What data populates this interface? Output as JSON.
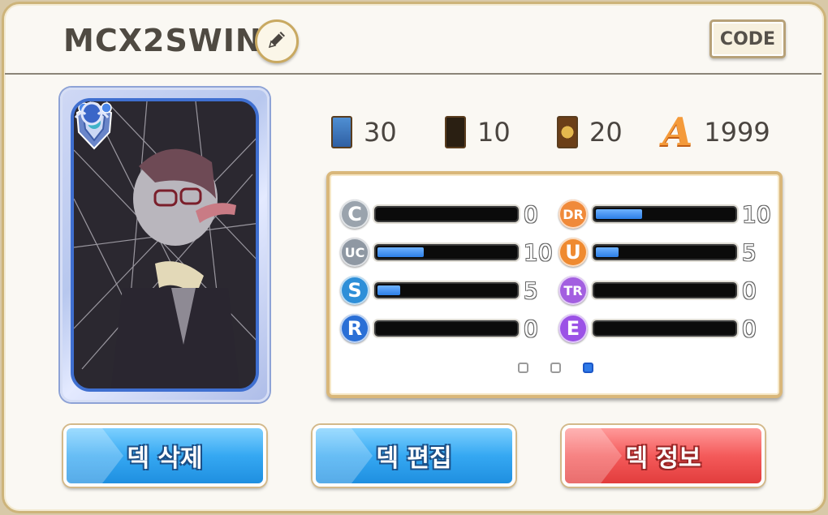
{
  "header": {
    "title": "MCX2SWIN",
    "code_label": "CODE"
  },
  "deck_counts": [
    {
      "icon": "blue-card-deck-icon",
      "value": "30"
    },
    {
      "icon": "silhouette-card-deck-icon",
      "value": "10"
    },
    {
      "icon": "gold-emblem-card-deck-icon",
      "value": "20"
    },
    {
      "icon": "rank-a-icon",
      "label": "A",
      "value": "1999"
    }
  ],
  "rarities": [
    {
      "label": "C",
      "value": "0",
      "fill": 0.0,
      "color": "#9aa3ad"
    },
    {
      "label": "UC",
      "value": "10",
      "fill": 0.33,
      "color": "#8f98a3"
    },
    {
      "label": "S",
      "value": "5",
      "fill": 0.16,
      "color": "#2e8fd8"
    },
    {
      "label": "R",
      "value": "0",
      "fill": 0.0,
      "color": "#2a6fd6"
    },
    {
      "label": "DR",
      "value": "10",
      "fill": 0.33,
      "color": "#f08a3a"
    },
    {
      "label": "U",
      "value": "5",
      "fill": 0.16,
      "color": "#ef8a30"
    },
    {
      "label": "TR",
      "value": "0",
      "fill": 0.0,
      "color": "#a35fe0"
    },
    {
      "label": "E",
      "value": "0",
      "fill": 0.0,
      "color": "#9b52e6"
    }
  ],
  "pagination": {
    "pages": 3,
    "active": 3
  },
  "buttons": {
    "delete_label": "덱 삭제",
    "edit_label": "덱 편집",
    "info_label": "덱 정보"
  },
  "colors": {
    "accent_blue": "#35a8f2",
    "accent_red": "#f45a5a",
    "frame_gold": "#cdb47a"
  }
}
